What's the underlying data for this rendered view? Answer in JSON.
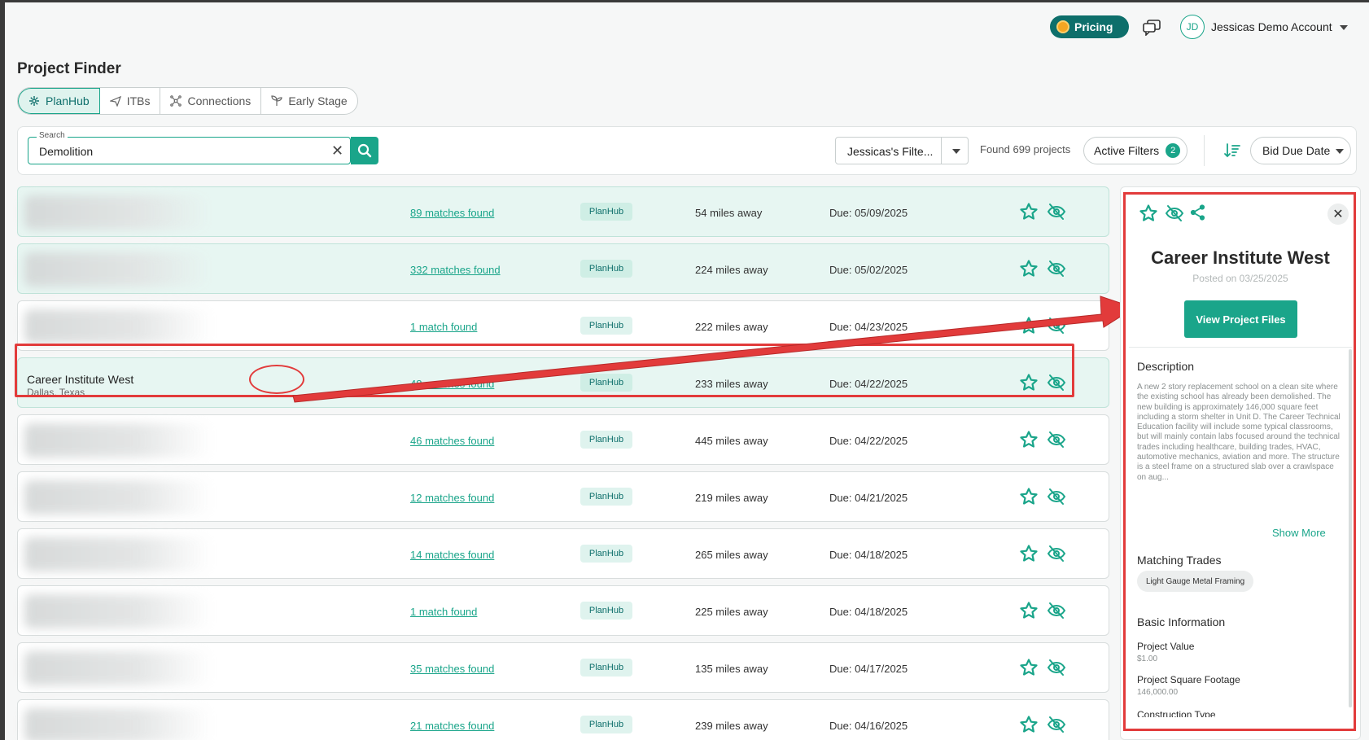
{
  "header": {
    "pricing_label": "Pricing",
    "avatar_initials": "JD",
    "account_name": "Jessicas Demo Account"
  },
  "page": {
    "title": "Project Finder"
  },
  "tabs": [
    {
      "label": "PlanHub",
      "icon": "planhub-icon",
      "active": true
    },
    {
      "label": "ITBs",
      "icon": "send-icon",
      "active": false
    },
    {
      "label": "Connections",
      "icon": "network-icon",
      "active": false
    },
    {
      "label": "Early Stage",
      "icon": "sprout-icon",
      "active": false
    }
  ],
  "search": {
    "label": "Search",
    "value": "Demolition",
    "saved_filter": "Jessicas's Filte...",
    "found_text": "Found 699 projects",
    "active_filters_label": "Active Filters",
    "active_filters_count": "2",
    "sort_label": "Bid Due Date"
  },
  "projects": [
    {
      "name": "",
      "location": "",
      "matches": "89 matches found",
      "source": "PlanHub",
      "distance": "54 miles away",
      "due": "Due: 05/09/2025",
      "tinted": true
    },
    {
      "name": "",
      "location": "",
      "matches": "332 matches found",
      "source": "PlanHub",
      "distance": "224 miles away",
      "due": "Due: 05/02/2025",
      "tinted": true
    },
    {
      "name": "",
      "location": "",
      "matches": "1 match found",
      "source": "PlanHub",
      "distance": "222 miles away",
      "due": "Due: 04/23/2025",
      "tinted": false
    },
    {
      "name": "Career Institute West",
      "location": "Dallas, Texas",
      "matches": "48 matches found",
      "source": "PlanHub",
      "distance": "233 miles away",
      "due": "Due: 04/22/2025",
      "tinted": true
    },
    {
      "name": "",
      "location": "",
      "matches": "46 matches found",
      "source": "PlanHub",
      "distance": "445 miles away",
      "due": "Due: 04/22/2025",
      "tinted": false
    },
    {
      "name": "",
      "location": "",
      "matches": "12 matches found",
      "source": "PlanHub",
      "distance": "219 miles away",
      "due": "Due: 04/21/2025",
      "tinted": false
    },
    {
      "name": "",
      "location": "",
      "matches": "14 matches found",
      "source": "PlanHub",
      "distance": "265 miles away",
      "due": "Due: 04/18/2025",
      "tinted": false
    },
    {
      "name": "",
      "location": "",
      "matches": "1 match found",
      "source": "PlanHub",
      "distance": "225 miles away",
      "due": "Due: 04/18/2025",
      "tinted": false
    },
    {
      "name": "",
      "location": "",
      "matches": "35 matches found",
      "source": "PlanHub",
      "distance": "135 miles away",
      "due": "Due: 04/17/2025",
      "tinted": false
    },
    {
      "name": "",
      "location": "",
      "matches": "21 matches found",
      "source": "PlanHub",
      "distance": "239 miles away",
      "due": "Due: 04/16/2025",
      "tinted": false
    }
  ],
  "detail": {
    "title": "Career Institute West",
    "posted": "Posted on 03/25/2025",
    "view_files_label": "View Project Files",
    "description_heading": "Description",
    "description": "A new 2 story replacement school on a clean site where the existing school has already been demolished. The new building is approximately 146,000 square feet including a storm shelter in Unit D. The Career Technical Education facility will include some typical classrooms, but will mainly contain labs focused around the technical trades including healthcare, building trades, HVAC, automotive mechanics, aviation and more. The structure is a steel frame on a structured slab over a crawlspace on aug...",
    "show_more_label": "Show More",
    "matching_trades_heading": "Matching Trades",
    "trade_chip": "Light Gauge Metal Framing",
    "basic_info_heading": "Basic Information",
    "project_value_label": "Project Value",
    "project_value": "$1.00",
    "square_footage_label": "Project Square Footage",
    "square_footage": "146,000.00",
    "construction_type_label": "Construction Type"
  },
  "colors": {
    "brand": "#1aa58a",
    "brand_dark": "#0e6f6b",
    "annotation": "#e23b3b"
  }
}
